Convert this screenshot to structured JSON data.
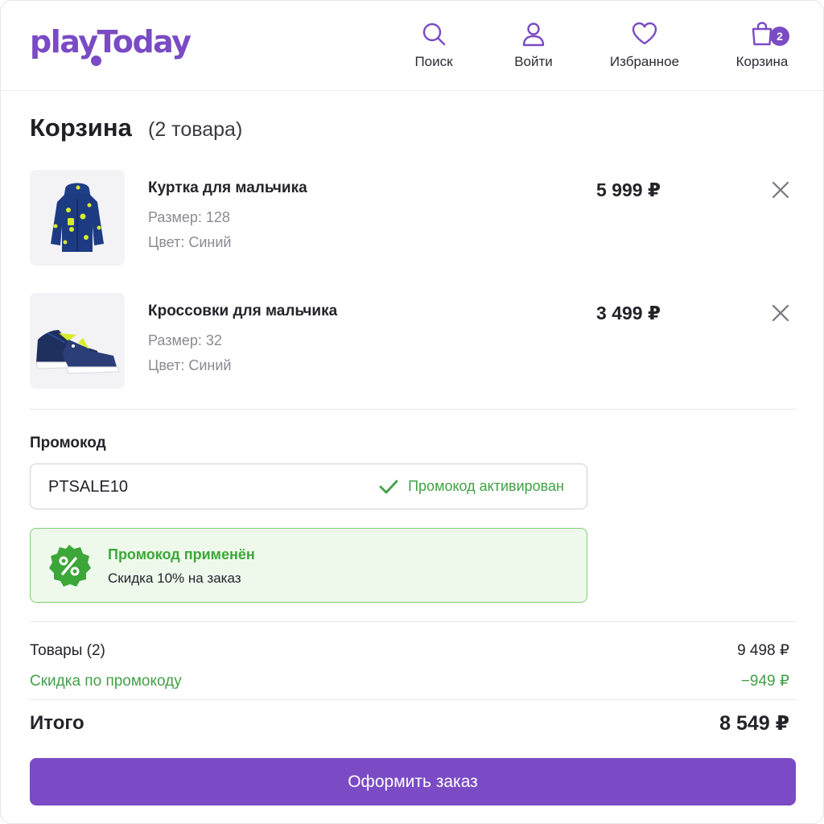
{
  "header": {
    "logo_text": "playToday",
    "nav": {
      "search_label": "Поиск",
      "login_label": "Войти",
      "favorites_label": "Избранное",
      "cart_label": "Корзина",
      "cart_count": "2"
    }
  },
  "cart": {
    "title": "Корзина",
    "count_text": "(2 товара)",
    "items": [
      {
        "name": "Куртка для мальчика",
        "size": "Размер: 128",
        "color": "Цвет: Синий",
        "price": "5 999 ₽"
      },
      {
        "name": "Кроссовки для мальчика",
        "size": "Размер: 32",
        "color": "Цвет: Синий",
        "price": "3 499 ₽"
      }
    ]
  },
  "promo": {
    "label": "Промокод",
    "value": "PTSALE10",
    "status": "Промокод активирован",
    "applied_title": "Промокод применён",
    "applied_text": "Скидка 10% на заказ"
  },
  "summary": {
    "goods_label": "Товары (2)",
    "goods_value": "9 498 ₽",
    "discount_label": "Скидка по промокоду",
    "discount_value": "−949 ₽",
    "total_label": "Итого",
    "total_value": "8 549 ₽"
  },
  "checkout": {
    "label": "Оформить заказ"
  },
  "colors": {
    "brand": "#7a4bc4",
    "success": "#43a047",
    "success_bg": "#eef9ec"
  },
  "icons": [
    "search-icon",
    "user-icon",
    "heart-icon",
    "bag-icon",
    "close-icon",
    "check-icon",
    "percent-badge-icon"
  ]
}
